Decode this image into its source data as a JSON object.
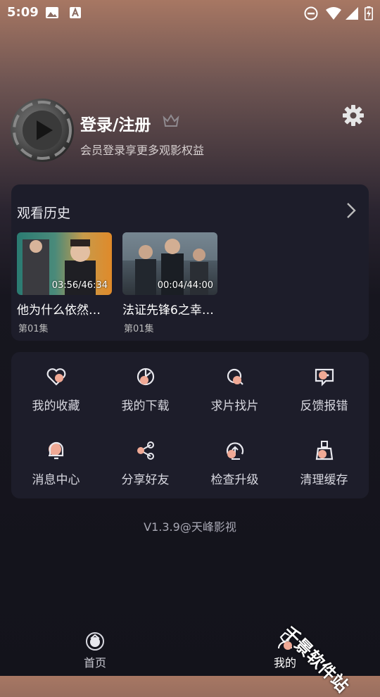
{
  "status_bar": {
    "time": "5:09"
  },
  "profile": {
    "title": "登录/注册",
    "subtitle": "会员登录享更多观影权益"
  },
  "history": {
    "heading": "观看历史",
    "items": [
      {
        "title": "他为什么依然…",
        "episode": "第01集",
        "duration": "03:56/46:34"
      },
      {
        "title": "法证先锋6之幸…",
        "episode": "第01集",
        "duration": "00:04/44:00"
      }
    ]
  },
  "menu": [
    {
      "label": "我的收藏",
      "icon": "favorites-icon"
    },
    {
      "label": "我的下载",
      "icon": "download-icon"
    },
    {
      "label": "求片找片",
      "icon": "request-icon"
    },
    {
      "label": "反馈报错",
      "icon": "feedback-icon"
    },
    {
      "label": "消息中心",
      "icon": "bell-icon"
    },
    {
      "label": "分享好友",
      "icon": "share-icon"
    },
    {
      "label": "检查升级",
      "icon": "upgrade-icon"
    },
    {
      "label": "清理缓存",
      "icon": "clean-icon"
    }
  ],
  "version": "V1.3.9@天峰影视",
  "tabbar": {
    "home": "首页",
    "mine": "我的"
  },
  "colors": {
    "accent": "#f0a995",
    "card": "#1d1d2a",
    "background": "#13131b"
  },
  "watermark": "千景软件站"
}
